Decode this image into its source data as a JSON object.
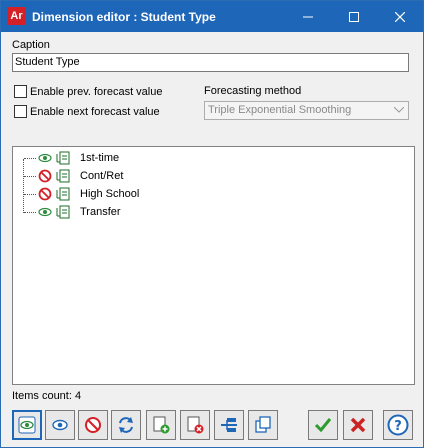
{
  "window": {
    "app_icon_text": "Ar",
    "title": "Dimension editor : Student Type"
  },
  "caption": {
    "label": "Caption",
    "value": "Student Type"
  },
  "options": {
    "enable_prev_label": "Enable prev. forecast value",
    "enable_next_label": "Enable next forecast value",
    "enable_prev_checked": false,
    "enable_next_checked": false,
    "forecasting_method_label": "Forecasting method",
    "forecasting_method_value": "Triple Exponential Smoothing"
  },
  "tree": {
    "items": [
      {
        "label": "1st-time",
        "state": "visible",
        "state_icon": "eye-icon"
      },
      {
        "label": "Cont/Ret",
        "state": "hidden",
        "state_icon": "no-entry-icon"
      },
      {
        "label": "High School",
        "state": "hidden",
        "state_icon": "no-entry-icon"
      },
      {
        "label": "Transfer",
        "state": "visible",
        "state_icon": "eye-icon"
      }
    ]
  },
  "status": {
    "items_count": "Items count: 4"
  },
  "toolbar": {
    "buttons": [
      "show-all-icon",
      "show-selected-icon",
      "hide-selected-icon",
      "refresh-icon",
      "add-folder-icon",
      "remove-folder-icon",
      "split-icon",
      "copy-icon",
      "ok-icon",
      "cancel-icon",
      "help-icon"
    ]
  },
  "colors": {
    "titlebar": "#1e66b8",
    "ok": "#2e9b2e",
    "cancel": "#cc2222",
    "help": "#1e66b8",
    "eye": "#2e8b3e",
    "no_entry": "#d42027"
  }
}
